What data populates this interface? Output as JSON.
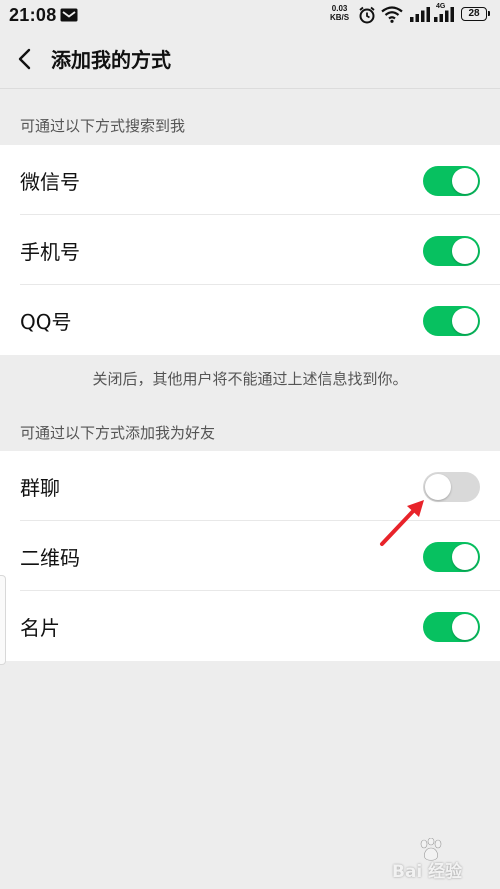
{
  "status_bar": {
    "time": "21:08",
    "net_speed_value": "0.03",
    "net_speed_unit": "KB/S",
    "network_type": "4G",
    "battery": "28"
  },
  "header": {
    "title": "添加我的方式"
  },
  "search_section": {
    "title": "可通过以下方式搜索到我",
    "items": [
      {
        "label": "微信号",
        "enabled": true
      },
      {
        "label": "手机号",
        "enabled": true
      },
      {
        "label": "QQ号",
        "enabled": true
      }
    ],
    "note": "关闭后，其他用户将不能通过上述信息找到你。"
  },
  "add_section": {
    "title": "可通过以下方式添加我为好友",
    "items": [
      {
        "label": "群聊",
        "enabled": false
      },
      {
        "label": "二维码",
        "enabled": true
      },
      {
        "label": "名片",
        "enabled": true
      }
    ]
  },
  "watermark": {
    "text": "Bai 经验"
  },
  "colors": {
    "toggle_on": "#07c160",
    "toggle_off": "#d9d9d9",
    "annotation_arrow": "#e8232a"
  }
}
